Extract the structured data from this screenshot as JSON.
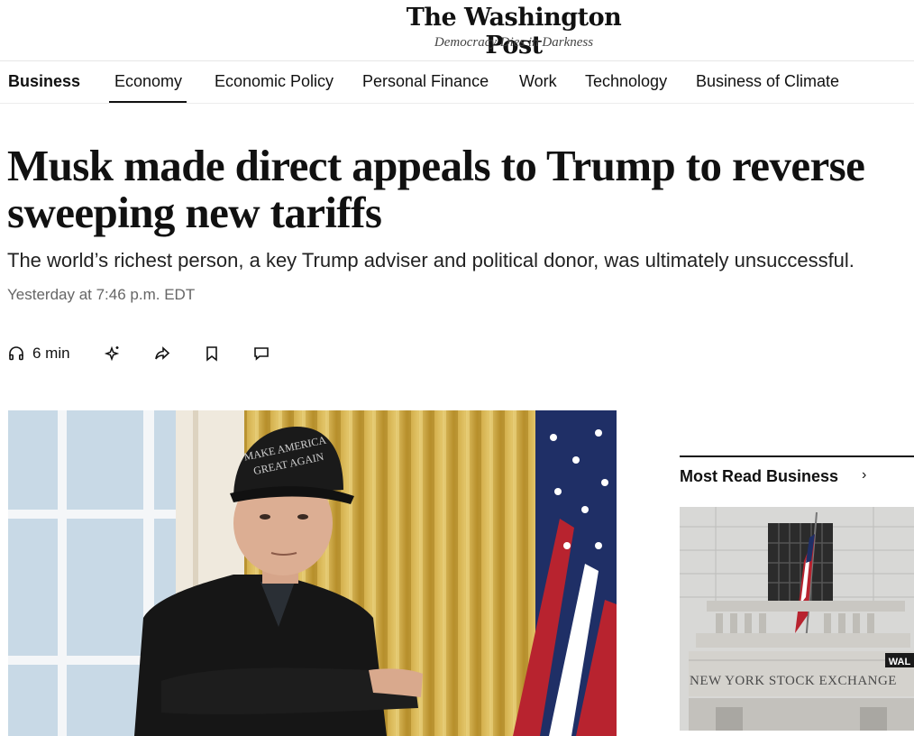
{
  "masthead": {
    "logo_text": "The Washington Post",
    "tagline": "Democracy Dies in Darkness"
  },
  "nav": {
    "items": [
      {
        "label": "Business",
        "active": true
      },
      {
        "label": "Economy",
        "selected": true
      },
      {
        "label": "Economic Policy"
      },
      {
        "label": "Personal Finance"
      },
      {
        "label": "Work"
      },
      {
        "label": "Technology"
      },
      {
        "label": "Business of Climate"
      }
    ]
  },
  "article": {
    "headline_line1": "Musk made direct appeals to Trump to reverse",
    "headline_line2": "sweeping new tariffs",
    "subhead": "The world’s richest person, a key Trump adviser and political donor, was ultimately unsuccessful.",
    "timestamp": "Yesterday at 7:46 p.m. EDT"
  },
  "toolbar": {
    "listen_label": "6 min",
    "icons": [
      "headphones-icon",
      "sparkle-icon",
      "share-icon",
      "bookmark-icon",
      "comment-icon"
    ]
  },
  "lead_image": {
    "cap_text_line1": "MAKE AMERICA",
    "cap_text_line2": "GREAT AGAIN"
  },
  "rail": {
    "title": "Most Read Business",
    "chevron": "›",
    "image": {
      "facade_text": "NEW YORK STOCK EXCHANGE",
      "sign_text": "WAL"
    }
  },
  "colors": {
    "text": "#111111",
    "muted": "#666666",
    "rule": "#e6e6e6"
  }
}
